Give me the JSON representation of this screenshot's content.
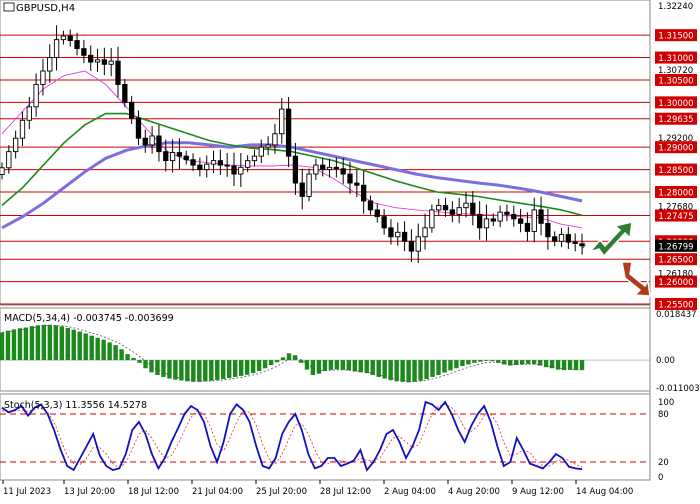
{
  "instrument": "GBPUSD,H4",
  "colors": {
    "candle": "#000000",
    "resistance": "#d00000",
    "ma_fast": "#e040e0",
    "ma_mid": "#1a8a1a",
    "ma_slow": "#7b6fe0",
    "price_tag": "#d00000",
    "macd_hist": "#1a8a1a",
    "stoch_main": "#1010c0",
    "stoch_signal": "#e03030",
    "arrow_up": "#2e7d32",
    "arrow_down": "#b03a1a"
  },
  "chart_data": [
    {
      "type": "candlestick",
      "title": "GBPUSD,H4",
      "ylim": [
        1.255,
        1.3224
      ],
      "y_ticks": [
        "1.32240",
        "1.30720",
        "1.29200",
        "1.27680",
        "1.26180",
        "1.25500"
      ],
      "levels": [
        "1.31500",
        "1.31000",
        "1.30500",
        "1.30000",
        "1.29635",
        "1.29000",
        "1.28500",
        "1.28000",
        "1.27475",
        "1.26900",
        "1.26500",
        "1.26000",
        "1.25500"
      ],
      "level_values": [
        1.315,
        1.31,
        1.305,
        1.3,
        1.29635,
        1.29,
        1.285,
        1.28,
        1.27475,
        1.269,
        1.265,
        1.26,
        1.255
      ],
      "last_price_label": "1.26799",
      "last_price": 1.26799,
      "close": [
        1.2854,
        1.289,
        1.292,
        1.296,
        1.299,
        1.304,
        1.307,
        1.31,
        1.314,
        1.3148,
        1.3138,
        1.312,
        1.3105,
        1.309,
        1.3095,
        1.3085,
        1.3092,
        1.304,
        1.3,
        1.2965,
        1.292,
        1.2905,
        1.2925,
        1.289,
        1.287,
        1.2888,
        1.288,
        1.2872,
        1.286,
        1.285,
        1.2862,
        1.287,
        1.286,
        1.2858,
        1.284,
        1.2855,
        1.287,
        1.288,
        1.29,
        1.2905,
        1.293,
        1.2985,
        1.288,
        1.282,
        1.279,
        1.284,
        1.286,
        1.285,
        1.2855,
        1.2852,
        1.284,
        1.282,
        1.2815,
        1.278,
        1.276,
        1.2745,
        1.272,
        1.27,
        1.271,
        1.269,
        1.2668,
        1.27,
        1.272,
        1.276,
        1.277,
        1.276,
        1.275,
        1.2765,
        1.2775,
        1.275,
        1.272,
        1.274,
        1.2735,
        1.2755,
        1.275,
        1.274,
        1.273,
        1.2712,
        1.276,
        1.273,
        1.27,
        1.269,
        1.2705,
        1.2688,
        1.2685,
        1.268
      ],
      "ma_fast": [
        1.293,
        1.298,
        1.303,
        1.306,
        1.307,
        1.304,
        1.299,
        1.294,
        1.289,
        1.287,
        1.2865,
        1.286,
        1.2858,
        1.2858,
        1.286,
        1.2855,
        1.283,
        1.28,
        1.2775,
        1.2765,
        1.276,
        1.2756,
        1.2752,
        1.275,
        1.2748,
        1.2745,
        1.2742,
        1.2728,
        1.272
      ],
      "ma_mid": [
        1.277,
        1.281,
        1.286,
        1.291,
        1.295,
        1.2975,
        1.2975,
        1.296,
        1.2945,
        1.293,
        1.2915,
        1.2905,
        1.2898,
        1.2895,
        1.289,
        1.288,
        1.287,
        1.2855,
        1.284,
        1.2825,
        1.2812,
        1.28,
        1.2795,
        1.279,
        1.2782,
        1.2775,
        1.2768,
        1.276,
        1.2748
      ],
      "ma_slow": [
        1.272,
        1.2745,
        1.2775,
        1.281,
        1.2845,
        1.2875,
        1.2893,
        1.2903,
        1.291,
        1.291,
        1.2905,
        1.29,
        1.2905,
        1.2905,
        1.29,
        1.289,
        1.288,
        1.287,
        1.286,
        1.285,
        1.284,
        1.2832,
        1.2826,
        1.282,
        1.2815,
        1.2808,
        1.28,
        1.279,
        1.278
      ]
    },
    {
      "type": "bar",
      "title": "MACD(5,34,4) -0.003745 -0.003699",
      "ylim": [
        -0.011003,
        0.018437
      ],
      "y_ticks": [
        "0.018437",
        "0.00",
        "-0.011003"
      ],
      "values": [
        0.0102,
        0.0108,
        0.0113,
        0.0117,
        0.012,
        0.0125,
        0.0128,
        0.013,
        0.013,
        0.0128,
        0.0124,
        0.0118,
        0.0112,
        0.0105,
        0.0098,
        0.009,
        0.0082,
        0.0075,
        0.0065,
        0.0055,
        0.004,
        0.0022,
        0.0008,
        -0.001,
        -0.003,
        -0.0045,
        -0.0055,
        -0.0062,
        -0.0068,
        -0.0072,
        -0.0075,
        -0.0078,
        -0.008,
        -0.008,
        -0.0078,
        -0.0076,
        -0.0073,
        -0.007,
        -0.0066,
        -0.0062,
        -0.0058,
        -0.0054,
        -0.0048,
        -0.004,
        -0.003,
        -0.0018,
        -0.0008,
        0.001,
        0.0025,
        0.0018,
        -0.001,
        -0.0035,
        -0.0055,
        -0.005,
        -0.004,
        -0.0036,
        -0.0034,
        -0.0036,
        -0.0038,
        -0.0042,
        -0.0045,
        -0.0048,
        -0.0055,
        -0.0062,
        -0.0068,
        -0.0074,
        -0.0078,
        -0.008,
        -0.0082,
        -0.008,
        -0.0076,
        -0.007,
        -0.0062,
        -0.0055,
        -0.0046,
        -0.0038,
        -0.003,
        -0.0022,
        -0.0016,
        -0.001,
        -0.0006,
        -0.0002,
        -0.0004,
        -0.001,
        -0.0016,
        -0.002,
        -0.0018,
        -0.0016,
        -0.0014,
        -0.0015,
        -0.002,
        -0.0026,
        -0.003,
        -0.0035,
        -0.0037,
        -0.0036,
        -0.0037,
        -0.0037
      ]
    },
    {
      "type": "line",
      "title": "Stoch(5,3,3) 11.3556 14.5278",
      "ylim": [
        0,
        100
      ],
      "y_ticks": [
        "100",
        "80",
        "20",
        "0"
      ],
      "levels": [
        80,
        20
      ],
      "series": [
        {
          "values": [
            88,
            82,
            85,
            90,
            78,
            88,
            92,
            80,
            60,
            35,
            15,
            10,
            25,
            40,
            55,
            28,
            15,
            10,
            12,
            30,
            60,
            70,
            55,
            30,
            12,
            25,
            45,
            62,
            80,
            90,
            85,
            70,
            40,
            20,
            45,
            80,
            92,
            85,
            70,
            40,
            15,
            12,
            25,
            55,
            70,
            80,
            60,
            30,
            12,
            15,
            25,
            25,
            15,
            18,
            22,
            35,
            10,
            20,
            35,
            55,
            60,
            45,
            25,
            40,
            60,
            95,
            92,
            85,
            95,
            80,
            60,
            45,
            65,
            80,
            90,
            70,
            40,
            15,
            20,
            50,
            35,
            18,
            15,
            12,
            20,
            30,
            25,
            14,
            12,
            11
          ]
        },
        {
          "values": [
            84,
            83,
            84,
            85,
            83,
            86,
            87,
            82,
            70,
            48,
            28,
            18,
            17,
            25,
            38,
            38,
            30,
            18,
            13,
            19,
            36,
            55,
            60,
            50,
            35,
            25,
            28,
            42,
            60,
            76,
            84,
            80,
            64,
            42,
            34,
            50,
            70,
            84,
            82,
            66,
            42,
            24,
            18,
            30,
            48,
            66,
            68,
            55,
            35,
            20,
            18,
            22,
            22,
            20,
            19,
            25,
            22,
            22,
            25,
            38,
            50,
            52,
            45,
            38,
            42,
            62,
            80,
            90,
            92,
            88,
            78,
            62,
            58,
            65,
            78,
            80,
            68,
            45,
            28,
            30,
            35,
            32,
            22,
            15,
            15,
            20,
            24,
            22,
            17,
            14
          ]
        }
      ]
    }
  ],
  "x_ticks": [
    "11 Jul 2023",
    "13 Jul 20:00",
    "18 Jul 12:00",
    "21 Jul 04:00",
    "25 Jul 20:00",
    "28 Jul 12:00",
    "2 Aug 04:00",
    "4 Aug 20:00",
    "9 Aug 12:00",
    "14 Aug 04:00"
  ]
}
